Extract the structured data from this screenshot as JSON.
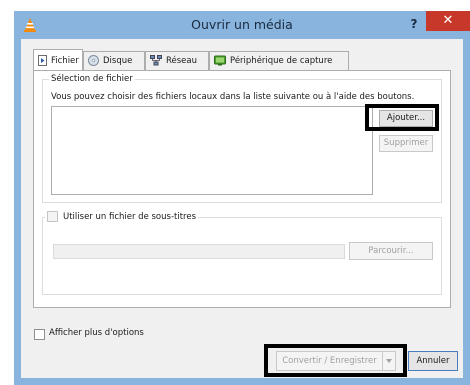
{
  "window": {
    "title": "Ouvrir un média",
    "help_label": "?",
    "close_label": "✕"
  },
  "tabs": [
    {
      "label": "Fichier",
      "icon": "file-icon",
      "active": true
    },
    {
      "label": "Disque",
      "icon": "disc-icon",
      "active": false
    },
    {
      "label": "Réseau",
      "icon": "network-icon",
      "active": false
    },
    {
      "label": "Périphérique de capture",
      "icon": "capture-device-icon",
      "active": false
    }
  ],
  "file_selection": {
    "group_title": "Sélection de fichier",
    "description": "Vous pouvez choisir des fichiers locaux dans la liste suivante ou à l'aide des boutons.",
    "add_label": "Ajouter...",
    "remove_label": "Supprimer"
  },
  "subtitles": {
    "checkbox_label": "Utiliser un fichier de sous-titres",
    "checked": false,
    "browse_label": "Parcourir..."
  },
  "footer": {
    "more_options_label": "Afficher plus d'options",
    "convert_label": "Convertir / Enregistrer",
    "cancel_label": "Annuler"
  },
  "colors": {
    "title_bar": "#89b4dd",
    "close_button": "#c7382b",
    "highlight_box": "#000000"
  }
}
